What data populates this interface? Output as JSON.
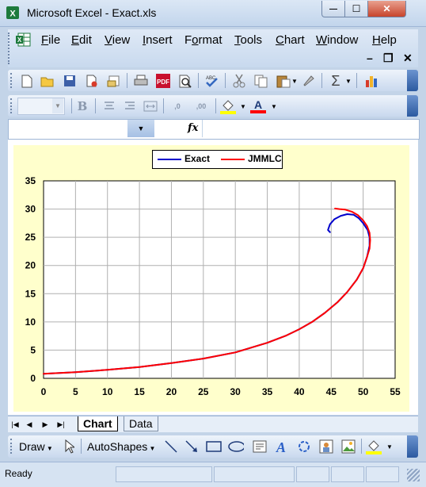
{
  "window": {
    "title": "Microsoft Excel - Exact.xls",
    "minimize_glyph": "—",
    "maximize_glyph": "☐",
    "close_glyph": "✕"
  },
  "menu": {
    "items": [
      {
        "label": "File",
        "accel": "F",
        "rest": "ile"
      },
      {
        "label": "Edit",
        "accel": "E",
        "rest": "dit"
      },
      {
        "label": "View",
        "accel": "V",
        "rest": "iew"
      },
      {
        "label": "Insert",
        "accel": "I",
        "rest": "nsert"
      },
      {
        "label": "Format",
        "pre": "F",
        "accel": "o",
        "rest": "rmat"
      },
      {
        "label": "Tools",
        "accel": "T",
        "rest": "ools"
      },
      {
        "label": "Chart",
        "accel": "C",
        "rest": "hart"
      },
      {
        "label": "Window",
        "accel": "W",
        "rest": "indow"
      },
      {
        "label": "Help",
        "accel": "H",
        "rest": "elp"
      }
    ],
    "doc_minimize": "–",
    "doc_restore": "❐",
    "doc_close": "✕"
  },
  "toolbar_standard": {
    "icons": [
      "new-icon",
      "open-icon",
      "save-icon",
      "permission-icon",
      "email-icon",
      "print-icon",
      "research-icon",
      "print-preview-icon",
      "spelling-icon",
      "cut-icon",
      "copy-icon",
      "paste-icon",
      "format-painter-icon",
      "autosum-icon",
      "chart-wizard-icon"
    ],
    "autosum_glyph": "Σ"
  },
  "toolbar_formatting": {
    "bold": "B",
    "font_color_letter": "A",
    "decrease_decimal": ",0",
    "increase_decimal": ",00",
    "fill_color": "#ffff00",
    "font_color": "#ff0000"
  },
  "formula_bar": {
    "name_box": "",
    "fx": "fx",
    "formula": ""
  },
  "chart_data": {
    "type": "line",
    "title": "",
    "xlabel": "",
    "ylabel": "",
    "xlim": [
      0,
      55
    ],
    "ylim": [
      0,
      35
    ],
    "xticks": [
      "0",
      "5",
      "10",
      "15",
      "20",
      "25",
      "30",
      "35",
      "40",
      "45",
      "50",
      "55"
    ],
    "yticks": [
      "0",
      "5",
      "10",
      "15",
      "20",
      "25",
      "30",
      "35"
    ],
    "grid": true,
    "legend_position": "top-center",
    "series": [
      {
        "name": "Exact",
        "color": "#0000cc",
        "x": [
          0,
          5,
          10,
          15,
          20,
          25,
          30,
          35,
          38,
          40,
          42,
          44,
          46,
          47.5,
          49,
          50,
          50.6,
          51,
          51,
          50.7,
          50,
          49.3,
          48.5,
          47.5,
          46.5,
          45.5,
          44.8,
          44.5,
          44.8
        ],
        "y": [
          0.8,
          1.1,
          1.5,
          2.0,
          2.7,
          3.5,
          4.6,
          6.3,
          7.6,
          8.7,
          10.0,
          11.6,
          13.5,
          15.3,
          17.5,
          19.5,
          21.5,
          23.5,
          25.0,
          26.3,
          27.5,
          28.4,
          29.0,
          29.1,
          28.8,
          28.2,
          27.3,
          26.3,
          25.9
        ]
      },
      {
        "name": "JMMLC",
        "color": "#ff0000",
        "x": [
          0,
          5,
          10,
          15,
          20,
          25,
          30,
          35,
          38,
          40,
          42,
          44,
          46,
          47.5,
          49,
          50,
          50.6,
          51,
          51.1,
          51,
          50.6,
          50,
          49.2,
          48.3,
          47.2,
          46.3,
          45.6
        ],
        "y": [
          0.8,
          1.1,
          1.5,
          2.0,
          2.7,
          3.5,
          4.6,
          6.3,
          7.6,
          8.7,
          10.0,
          11.6,
          13.5,
          15.3,
          17.5,
          19.5,
          21.5,
          23.0,
          24.5,
          25.8,
          27.0,
          28.0,
          28.9,
          29.5,
          29.9,
          30.0,
          30.1
        ]
      }
    ]
  },
  "sheet_tabs": {
    "nav": [
      "|◀",
      "◀",
      "▶",
      "▶|"
    ],
    "tabs": [
      "Chart",
      "Data"
    ],
    "active": "Chart"
  },
  "drawing_toolbar": {
    "draw_label": "Draw",
    "draw_accel": "r",
    "autoshapes_label": "AutoShapes",
    "autoshapes_accel": "u"
  },
  "status": {
    "text": "Ready"
  }
}
